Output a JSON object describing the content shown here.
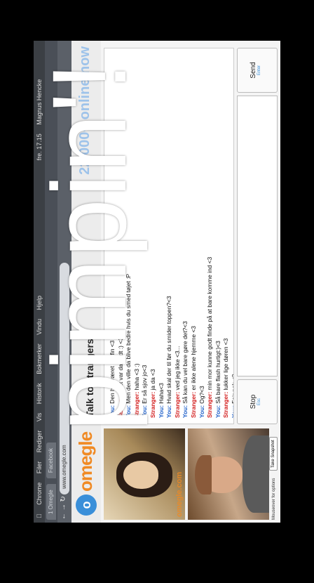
{
  "overlay_text": "pimpin'!",
  "browser": {
    "menu": [
      "Chrome",
      "Filer",
      "Rediger",
      "Vis",
      "Historik",
      "Bokmerker",
      "Vindu",
      "Hjelp"
    ],
    "clock": "fre. 17.15",
    "user": "Magnus Hencke",
    "tabs": [
      "1 Omegle",
      "Facebook"
    ],
    "url": "www.omegle.com",
    "bookmarks": "Nettbank",
    "nav_icons": [
      "back-icon",
      "forward-icon",
      "reload-icon"
    ]
  },
  "site": {
    "brand": "omegle",
    "tagline": "Talk to strangers!",
    "online_count": "22,000+ online now",
    "video_watermark": "omegle.com"
  },
  "chat": [
    {
      "who": "You:",
      "text": "Den har været hel fin <3"
    },
    {
      "who": "Stranger:",
      "text": "det var da godt :) <3"
    },
    {
      "who": "You:",
      "text": "Men den ville da blive bedre hvis du smed tøjet :P"
    },
    {
      "who": "Stranger:",
      "text": "haha <3 :)"
    },
    {
      "who": "You:",
      "text": "Er så sjov jo<3"
    },
    {
      "who": "Stranger:",
      "text": "ja da <3"
    },
    {
      "who": "You:",
      "text": "Haha<3"
    },
    {
      "who": "You:",
      "text": "Hvad skal der til før du smider toppen?<3"
    },
    {
      "who": "Stranger:",
      "text": "ved jeg ikke <3..."
    },
    {
      "who": "You:",
      "text": "Så kan du vel bare gøre det?<3"
    },
    {
      "who": "Stranger:",
      "text": "er ikke alene hjemme <3"
    },
    {
      "who": "You:",
      "text": "Og?<3"
    },
    {
      "who": "Stranger:",
      "text": "min mor kunne godt finde på at bare komme ind <3"
    },
    {
      "who": "You:",
      "text": "Så bare flash hurtigt:)<3"
    },
    {
      "who": "Stranger:",
      "text": "lukker lige døren <3"
    },
    {
      "who": "You:",
      "text": "Fair nok <3"
    }
  ],
  "controls": {
    "stop_label": "Stop",
    "stop_hint": "Esc",
    "send_label": "Send",
    "send_hint": "Enter",
    "mouseover_note": "Mouseover for options",
    "snapshot_label": "Take Snapshot"
  },
  "colors": {
    "you": "#1d5fc9",
    "stranger": "#d31f1f",
    "brand_orange": "#f08a24",
    "brand_blue": "#3a8fd9"
  }
}
